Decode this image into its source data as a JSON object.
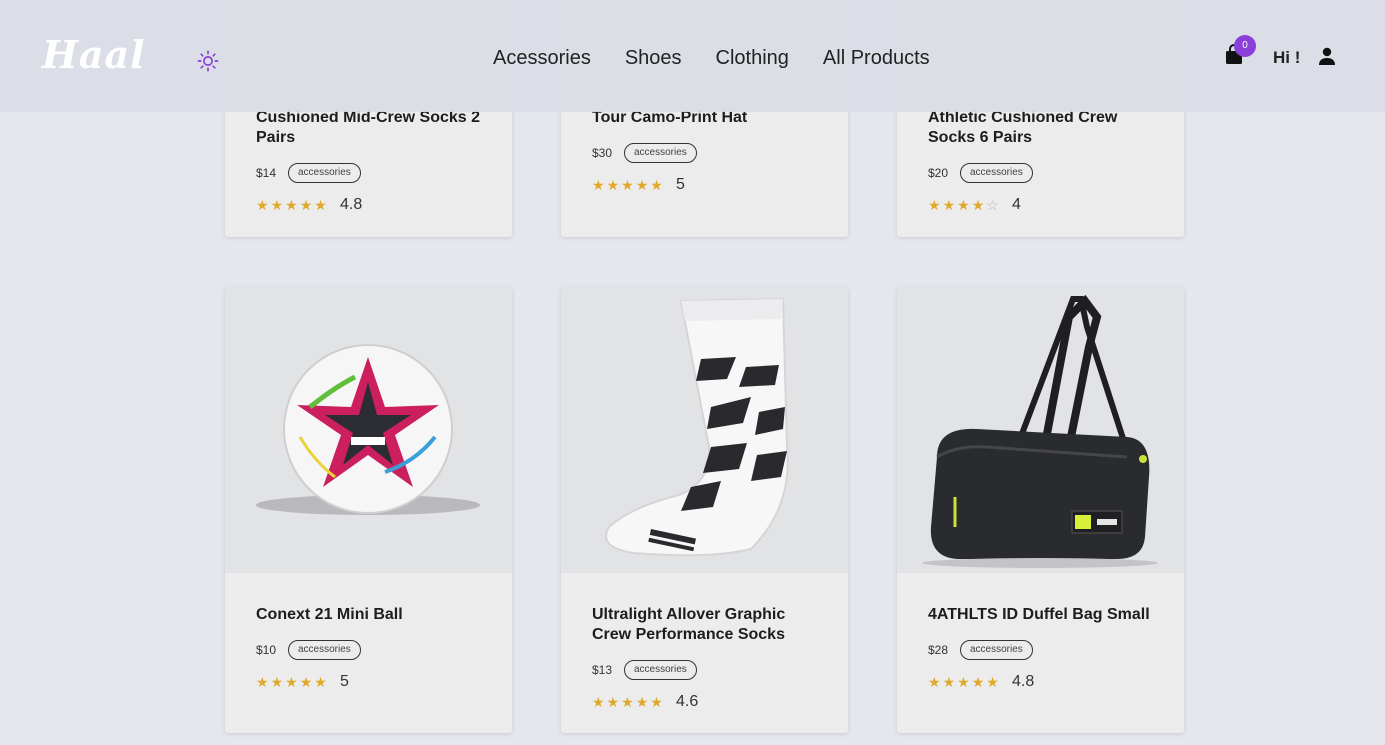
{
  "brand": {
    "logo": "Haal"
  },
  "nav": [
    "Acessories",
    "Shoes",
    "Clothing",
    "All Products"
  ],
  "cart": {
    "count": "0"
  },
  "greeting": "Hi !",
  "products_top": [
    {
      "title": "Cushioned Mid-Crew Socks 2 Pairs",
      "price": "$14",
      "tag": "accessories",
      "rating": 4.8,
      "rating_label": "4.8"
    },
    {
      "title": "Tour Camo-Print Hat",
      "price": "$30",
      "tag": "accessories",
      "rating": 5,
      "rating_label": "5"
    },
    {
      "title": "Athletic Cushioned Crew Socks 6 Pairs",
      "price": "$20",
      "tag": "accessories",
      "rating": 4,
      "rating_label": "4"
    }
  ],
  "products": [
    {
      "title": "Conext 21 Mini Ball",
      "price": "$10",
      "tag": "accessories",
      "rating": 5,
      "rating_label": "5"
    },
    {
      "title": "Ultralight Allover Graphic Crew Performance Socks",
      "price": "$13",
      "tag": "accessories",
      "rating": 4.6,
      "rating_label": "4.6"
    },
    {
      "title": "4ATHLTS ID Duffel Bag Small",
      "price": "$28",
      "tag": "accessories",
      "rating": 4.8,
      "rating_label": "4.8"
    }
  ],
  "colors": {
    "accent": "#8b3fd9",
    "star": "#e0a92c",
    "background": "#e4e7ee"
  }
}
